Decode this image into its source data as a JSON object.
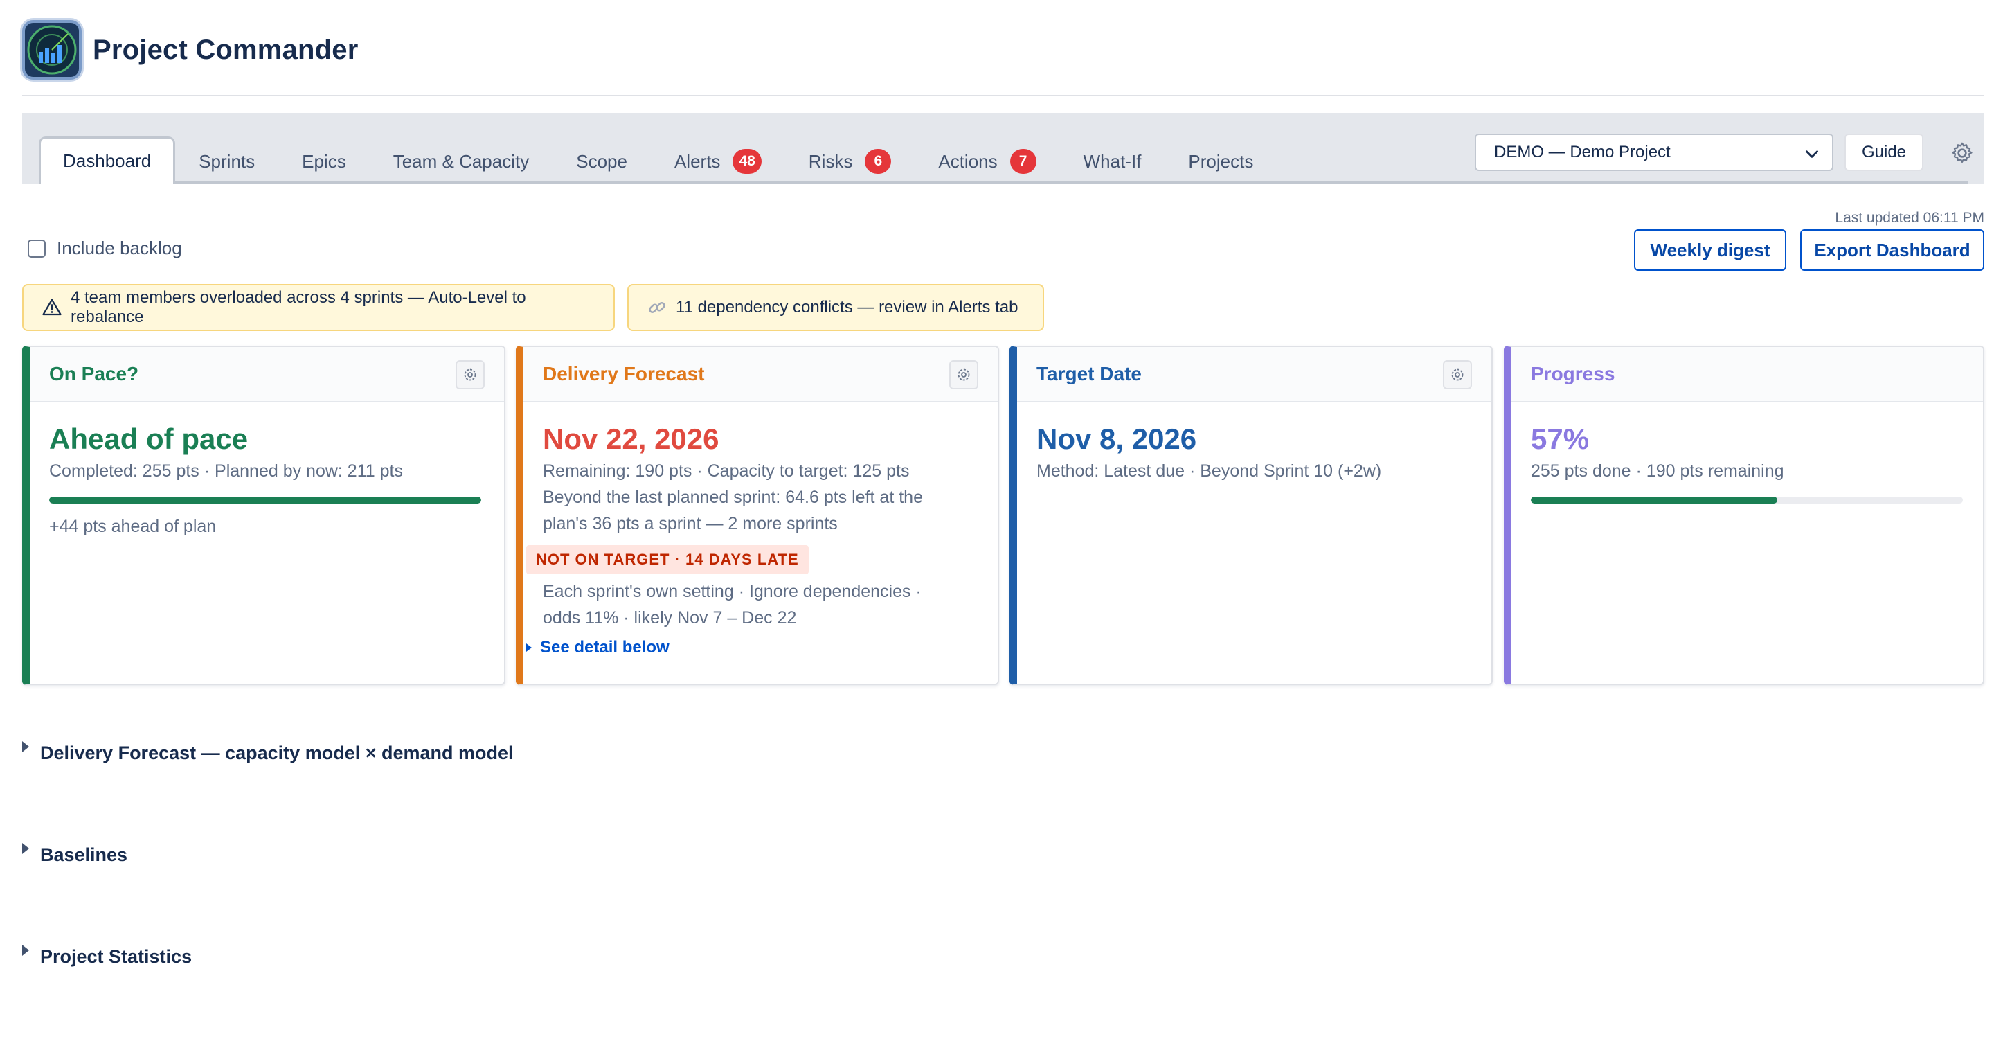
{
  "app": {
    "title": "Project Commander",
    "logo_icon": "radar-chart-icon"
  },
  "nav": {
    "tabs": [
      {
        "label": "Dashboard",
        "active": true
      },
      {
        "label": "Sprints"
      },
      {
        "label": "Epics"
      },
      {
        "label": "Team & Capacity"
      },
      {
        "label": "Scope"
      },
      {
        "label": "Alerts",
        "badge": "48"
      },
      {
        "label": "Risks",
        "badge": "6"
      },
      {
        "label": "Actions",
        "badge": "7"
      },
      {
        "label": "What-If"
      },
      {
        "label": "Projects"
      }
    ],
    "project_select": {
      "selected": "DEMO — Demo Project"
    },
    "guide_label": "Guide",
    "settings_icon": "gear-icon"
  },
  "toolbar": {
    "last_updated": "Last updated 06:11 PM",
    "include_backlog_label": "Include backlog",
    "include_backlog_checked": false,
    "weekly_digest_label": "Weekly digest",
    "export_label": "Export Dashboard"
  },
  "notices": [
    {
      "icon": "warning-icon",
      "text": "4 team members overloaded across 4 sprints — Auto-Level to rebalance"
    },
    {
      "icon": "link-icon",
      "text": "11 dependency conflicts — review in Alerts tab"
    }
  ],
  "cards": {
    "pace": {
      "title": "On Pace?",
      "value": "Ahead of pace",
      "line1": "Completed: 255 pts · Planned by now: 211 pts",
      "progress": 1.0,
      "footer": "+44 pts ahead of plan",
      "color": "#1a7f54"
    },
    "forecast": {
      "title": "Delivery Forecast",
      "value": "Nov 22, 2026",
      "line1": "Remaining: 190 pts · Capacity to target: 125 pts",
      "line2": "Beyond the last planned sprint: 64.6 pts left at the",
      "line3": "plan's 36 pts a sprint — 2 more sprints",
      "chip": "NOT ON TARGET · 14 DAYS LATE",
      "line4": "Each sprint's own setting · Ignore dependencies ·",
      "line5": "odds 11% · likely Nov 7 – Dec 22",
      "link": "See detail below",
      "title_color": "#e0781a",
      "value_color": "#e04a3f"
    },
    "target": {
      "title": "Target Date",
      "value": "Nov 8, 2026",
      "line1": "Method: Latest due · Beyond Sprint 10 (+2w)",
      "color": "#1f5ea8"
    },
    "progress": {
      "title": "Progress",
      "value": "57%",
      "line1": "255 pts done · 190 pts remaining",
      "progress": 0.57,
      "color": "#8a79e0"
    }
  },
  "sections": [
    {
      "title": "Delivery Forecast — capacity model × demand model"
    },
    {
      "title": "Baselines"
    },
    {
      "title": "Project Statistics"
    }
  ]
}
